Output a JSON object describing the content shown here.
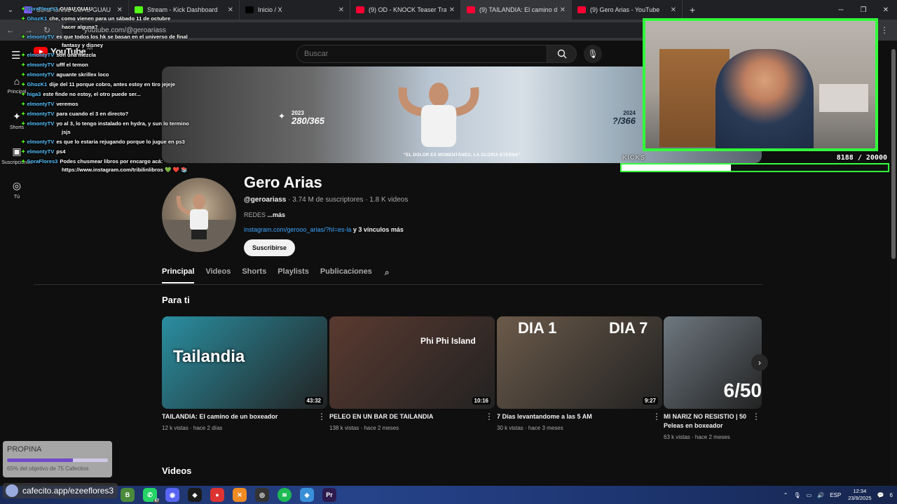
{
  "browser": {
    "tabs": [
      {
        "title": "SoraFlores3  GUAU GUAU",
        "favicon_color": "#7b61ff",
        "active": false
      },
      {
        "title": "Stream - Kick Dashboard",
        "favicon_color": "#53fc18",
        "active": false
      },
      {
        "title": "Inicio / X",
        "favicon_color": "#000000",
        "active": false
      },
      {
        "title": "(9) OD - KNOCK Teaser Trailer -",
        "favicon_color": "#ff0033",
        "active": false
      },
      {
        "title": "(9) TAILANDIA: El camino de",
        "favicon_color": "#ff0033",
        "active": true
      },
      {
        "title": "(9) Gero Arias - YouTube",
        "favicon_color": "#ff0033",
        "active": false
      }
    ],
    "url": "youtube.com/@geroariass"
  },
  "youtube": {
    "logo_text": "YouTube",
    "logo_suffix": "AR",
    "search_placeholder": "Buscar",
    "guide": [
      {
        "icon": "⌂",
        "label": "Principal"
      },
      {
        "icon": "✦",
        "label": "Shorts"
      },
      {
        "icon": "▣",
        "label": "Suscripciones"
      },
      {
        "icon": "◎",
        "label": "Tú"
      }
    ],
    "banner": {
      "year_left": "2023",
      "count_left": "280/365",
      "year_right": "2024",
      "count_right": "?/366",
      "quote": "\"EL DOLOR ES MOMENTÁNEO, LA GLORIA ETERNA\""
    },
    "channel": {
      "name": "Gero Arias",
      "handle": "@geroariass",
      "subscribers": "3.74 M de suscriptores",
      "videos": "1.8 K videos",
      "desc": "REDES",
      "more": "...más",
      "link": "instagram.com/gerooo_arias/?hl=es-la",
      "links_more": "y 3 vínculos más",
      "subscribe": "Suscribirse"
    },
    "tabs": [
      "Principal",
      "Videos",
      "Shorts",
      "Playlists",
      "Publicaciones"
    ],
    "section_for_you": "Para ti",
    "section_videos": "Videos",
    "videos": [
      {
        "title": "TAILANDIA: El camino de un boxeador",
        "views": "12 k vistas",
        "age": "hace 2 días",
        "duration": "43:32",
        "overlay": "Tailandia",
        "bg": "#2a8ea0"
      },
      {
        "title": "PELEO EN UN BAR DE TAILANDIA",
        "views": "138 k vistas",
        "age": "hace 2 meses",
        "duration": "10:16",
        "overlay": "Phi Phi Island",
        "bg": "#5a3a30"
      },
      {
        "title": "7 Días levantandome a las 5 AM",
        "views": "30 k vistas",
        "age": "hace 3 meses",
        "duration": "9:27",
        "overlay_left": "DIA 1",
        "overlay_right": "DIA 7",
        "bg": "#6b5a4a"
      },
      {
        "title": "MI NARIZ NO RESISTIO | 50 Peleas en boxeador",
        "views": "63 k vistas",
        "age": "hace 2 meses",
        "duration": "",
        "overlay": "6/50",
        "bg": "#6e7880"
      }
    ]
  },
  "chat": [
    {
      "user": "SoraFlores3",
      "text": "GUAU GUAU"
    },
    {
      "user": "GhozK1",
      "text": "che, como vienen para un sábado 11 de octubre",
      "cont": "hacer alguna?"
    },
    {
      "user": "elmontyTV",
      "text": "es que todos los hk se basan en el universo de final",
      "cont": "fantasy y disney"
    },
    {
      "user": "elmontyTV",
      "text": "son una mezcla"
    },
    {
      "user": "elmontyTV",
      "text": "ufff el temon"
    },
    {
      "user": "elmontyTV",
      "text": "aguante skrillex loco"
    },
    {
      "user": "GhozK1",
      "text": "dije del 11 porque cobro, antes estoy en tiro jejeje"
    },
    {
      "user": "higa3",
      "text": "este finde no estoy, el otro puede ser..."
    },
    {
      "user": "elmontyTV",
      "text": "veremos"
    },
    {
      "user": "elmontyTV",
      "text": "para cuando el 3 en directo?"
    },
    {
      "user": "elmontyTV",
      "text": "yo al 3, lo tengo instalado en hydra, y sun lo termino",
      "cont": "jsjs"
    },
    {
      "user": "elmontyTV",
      "text": "es que lo estaria rejugando porque lo jugue en ps3"
    },
    {
      "user": "elmontyTV",
      "text": "ps4"
    },
    {
      "user": "SoraFlores3",
      "text": "Podes chusmear libros por encargo acá:",
      "cont": "https://www.instagram.com/tribilinlibros 💚 ❤️ 📚"
    }
  ],
  "overlay": {
    "kicks_label": "KICKS",
    "kicks_current": "8188",
    "kicks_goal": "20000",
    "kicks_fraction": 0.41,
    "propina_title": "PROPINA",
    "propina_status": "65% del objetivo de 75 Cafecitos",
    "propina_fraction": 0.65,
    "cafecito_link": "cafecito.app/ezeeflores3"
  },
  "taskbar": {
    "badge": "47",
    "lang": "ESP",
    "time": "12:34",
    "date": "23/9/2025",
    "notif": "6"
  }
}
